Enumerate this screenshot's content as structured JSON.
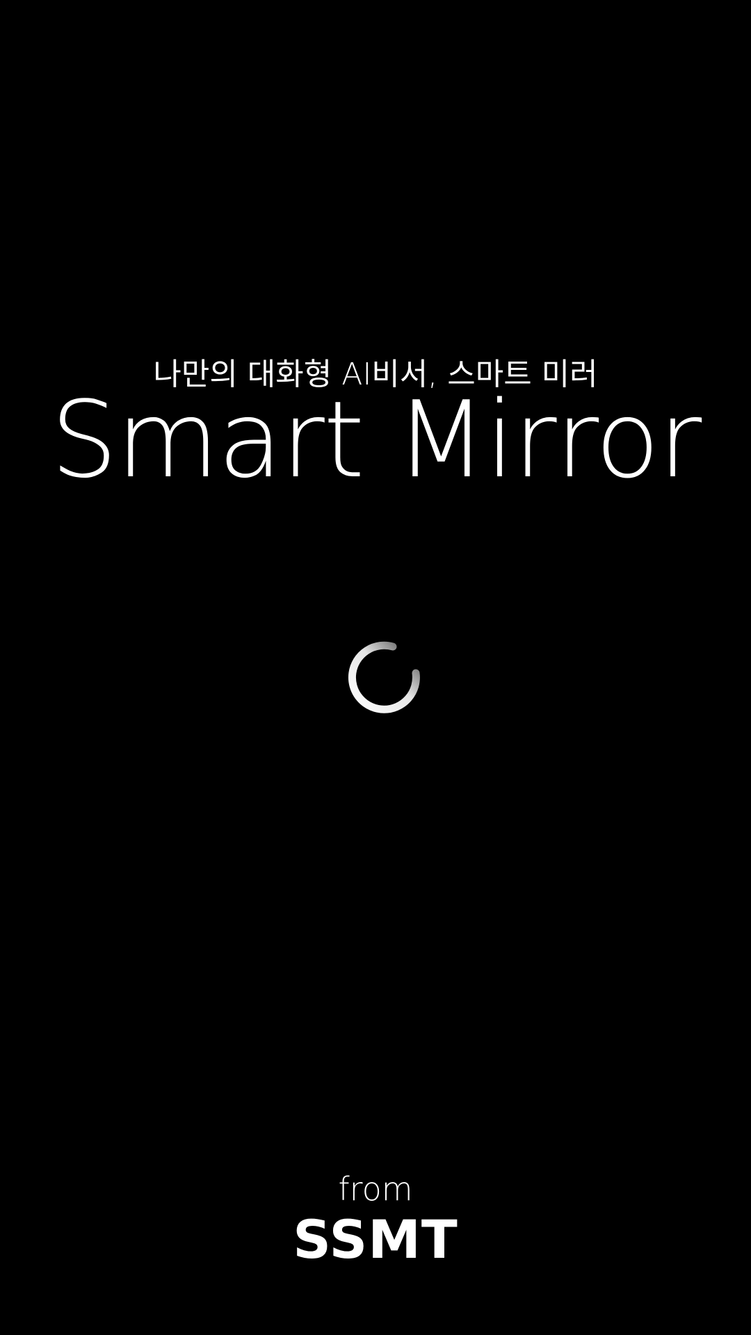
{
  "splash": {
    "subtitle": "나만의 대화형 AI비서, 스마트 미러",
    "title": "Smart Mirror",
    "footer": {
      "from_label": "from",
      "brand": "SSMT"
    }
  },
  "colors": {
    "background": "#000000",
    "text": "#ffffff",
    "spinner_start": "#ffffff",
    "spinner_end": "#555555"
  },
  "icons": {
    "spinner": "loading-spinner-icon"
  }
}
